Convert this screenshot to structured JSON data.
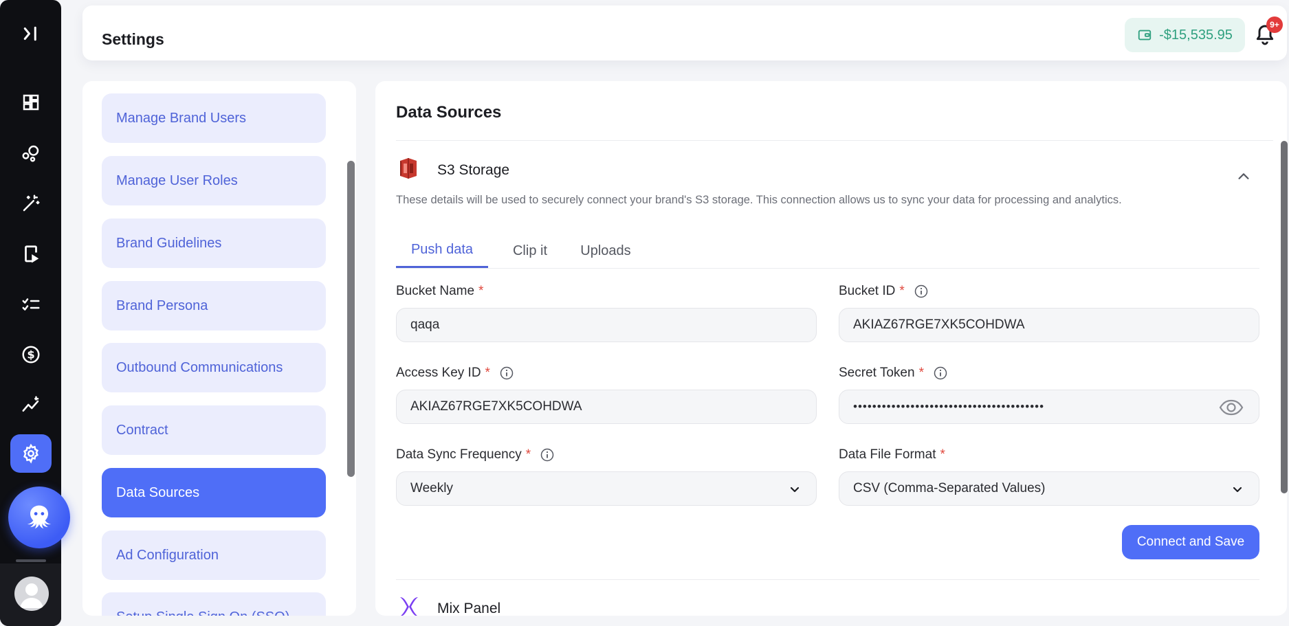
{
  "header": {
    "title": "Settings",
    "balance": "-$15,535.95",
    "notification_badge": "9+"
  },
  "rail": {
    "items": [
      {
        "icon": "expand-icon"
      },
      {
        "icon": "dashboard-icon"
      },
      {
        "icon": "nodes-icon"
      },
      {
        "icon": "magic-wand-icon"
      },
      {
        "icon": "video-device-icon"
      },
      {
        "icon": "checklist-icon"
      },
      {
        "icon": "dollar-icon"
      },
      {
        "icon": "analytics-icon"
      },
      {
        "icon": "gear-icon",
        "active": true
      }
    ]
  },
  "menu": {
    "items": [
      {
        "label": "Manage Brand Users"
      },
      {
        "label": "Manage User Roles"
      },
      {
        "label": "Brand Guidelines"
      },
      {
        "label": "Brand Persona"
      },
      {
        "label": "Outbound Communications"
      },
      {
        "label": "Contract"
      },
      {
        "label": "Data Sources",
        "active": true
      },
      {
        "label": "Ad Configuration"
      },
      {
        "label": "Setup Single Sign On (SSO)"
      }
    ]
  },
  "content": {
    "title": "Data Sources",
    "s3": {
      "title": "S3 Storage",
      "description": "These details will be used to securely connect your brand's S3 storage. This connection allows us to sync your data for processing and analytics.",
      "tabs": [
        {
          "label": "Push data",
          "active": true
        },
        {
          "label": "Clip it"
        },
        {
          "label": "Uploads"
        }
      ],
      "fields": {
        "bucket_name": {
          "label": "Bucket Name",
          "value": "qaqa"
        },
        "bucket_id": {
          "label": "Bucket ID",
          "value": "AKIAZ67RGE7XK5COHDWA"
        },
        "access_key_id": {
          "label": "Access Key ID",
          "value": "AKIAZ67RGE7XK5COHDWA"
        },
        "secret_token": {
          "label": "Secret Token",
          "value": "••••••••••••••••••••••••••••••••••••••••"
        },
        "sync_frequency": {
          "label": "Data Sync Frequency",
          "value": "Weekly"
        },
        "file_format": {
          "label": "Data File Format",
          "value": "CSV (Comma-Separated Values)"
        }
      },
      "required_mark": "*",
      "submit_label": "Connect and Save"
    },
    "mixpanel": {
      "title": "Mix Panel"
    }
  },
  "colors": {
    "accent": "#4f6ef7",
    "menu_text": "#4f63d8",
    "menu_bg": "#ebedfd",
    "balance_text": "#2fa07f",
    "required": "#e0483d"
  }
}
